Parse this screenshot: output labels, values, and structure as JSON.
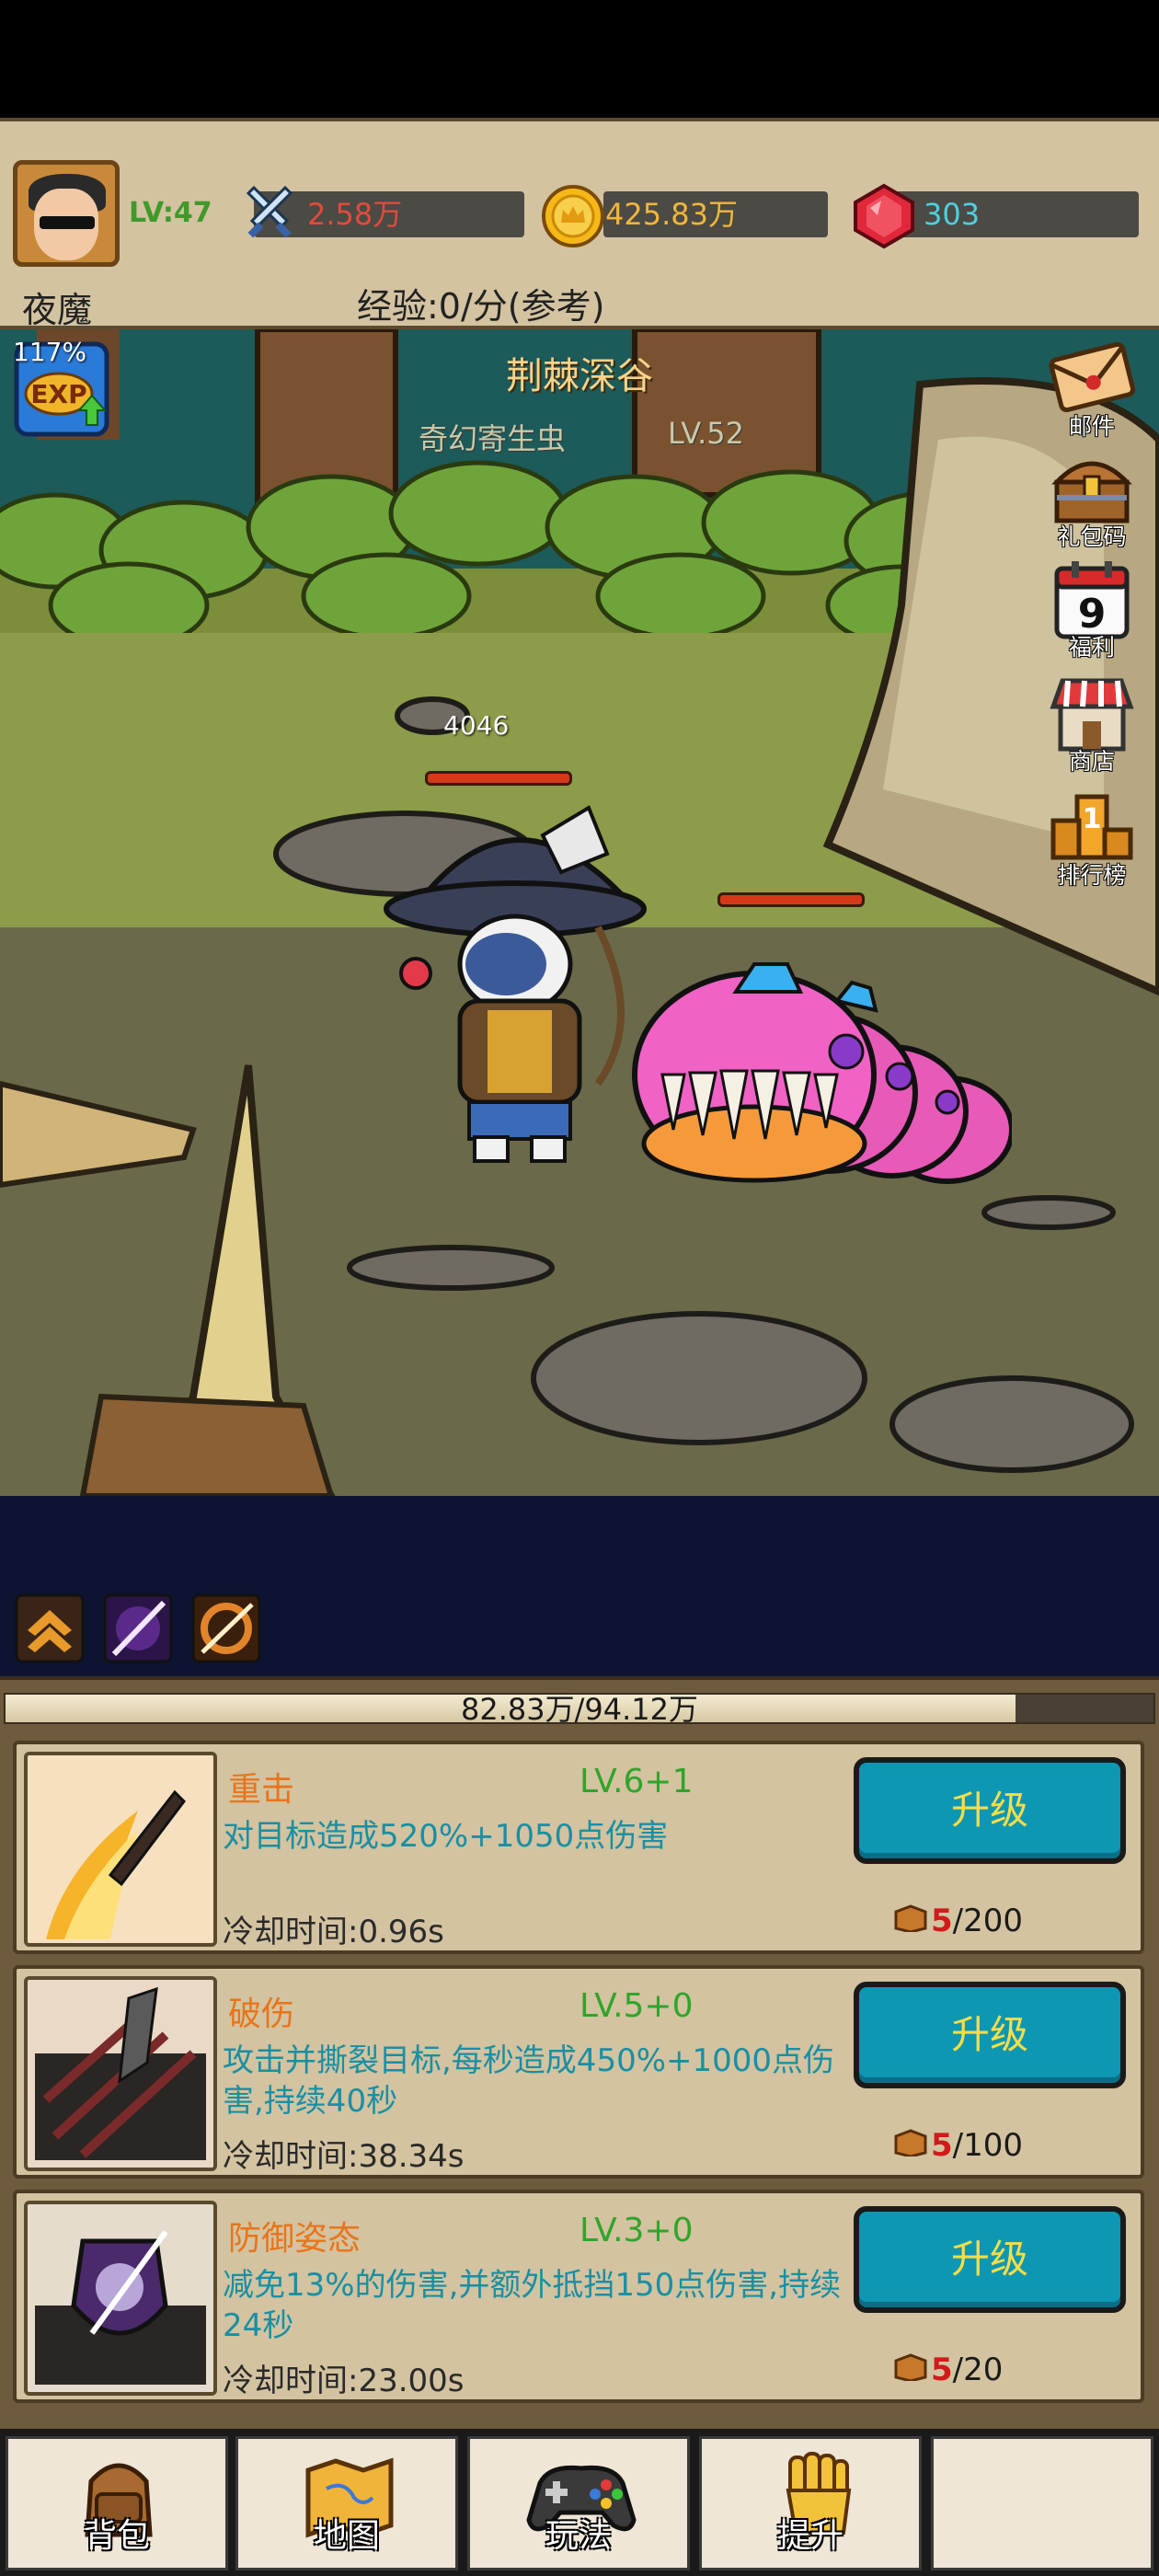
{
  "player": {
    "level": "LV:47",
    "name": "夜魔",
    "power": "2.58万",
    "gold": "425.83万",
    "gems": "303",
    "exp_rate": "经验:0/分(参考)"
  },
  "battle": {
    "exp_boost_pct": "117%",
    "stage_name": "荆棘深谷",
    "enemy_name": "奇幻寄生虫",
    "enemy_level": "LV.52",
    "damage_number": "4046"
  },
  "side_menu": [
    {
      "label": "邮件",
      "icon": "mail-icon"
    },
    {
      "label": "礼包码",
      "icon": "gift-chest-icon"
    },
    {
      "label": "福利",
      "icon": "calendar-icon",
      "badge": "9"
    },
    {
      "label": "商店",
      "icon": "shop-icon"
    },
    {
      "label": "排行榜",
      "icon": "ranking-icon",
      "badge": "1"
    }
  ],
  "buffs": [
    "rank-up-buff-icon",
    "purple-slash-buff-icon",
    "orange-slash-buff-icon"
  ],
  "exp_bar": {
    "text": "82.83万/94.12万",
    "fill_fraction": 0.88
  },
  "skills": [
    {
      "name": "重击",
      "level": "LV.6+1",
      "desc": "对目标造成520%+1050点伤害",
      "cooldown": "冷却时间:0.96s",
      "button": "升级",
      "cost_have": "5",
      "cost_need": "/200"
    },
    {
      "name": "破伤",
      "level": "LV.5+0",
      "desc": "攻击并撕裂目标,每秒造成450%+1000点伤害,持续40秒",
      "cooldown": "冷却时间:38.34s",
      "button": "升级",
      "cost_have": "5",
      "cost_need": "/100"
    },
    {
      "name": "防御姿态",
      "level": "LV.3+0",
      "desc": "减免13%的伤害,并额外抵挡150点伤害,持续24秒",
      "cooldown": "冷却时间:23.00s",
      "button": "升级",
      "cost_have": "5",
      "cost_need": "/20"
    }
  ],
  "nav": [
    {
      "label": "背包",
      "icon": "backpack-icon"
    },
    {
      "label": "地图",
      "icon": "map-icon"
    },
    {
      "label": "玩法",
      "icon": "gamepad-icon"
    },
    {
      "label": "提升",
      "icon": "fist-icon"
    },
    {
      "label": "",
      "icon": ""
    }
  ],
  "colors": {
    "panel_tan": "#d3c3a0",
    "upgrade_button": "#0e97b3",
    "upgrade_text": "#f7de48",
    "skill_name": "#e8751a",
    "skill_level": "#2fa52a",
    "skill_desc": "#198fa4"
  }
}
